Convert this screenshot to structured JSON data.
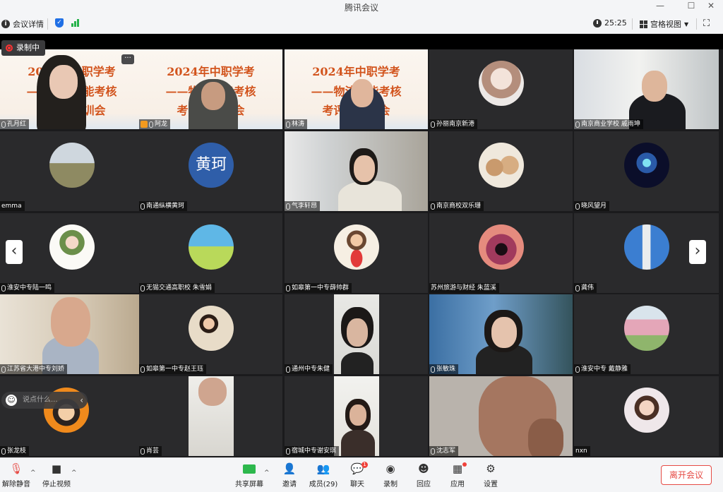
{
  "window": {
    "title": "腾讯会议",
    "minimize": "—",
    "maximize": "☐",
    "close": "✕"
  },
  "infobar": {
    "meeting_info": "会议详情",
    "timer": "25:25",
    "view_mode": "宫格视图"
  },
  "recording_badge": "录制中",
  "chat": {
    "placeholder": "说点什么..."
  },
  "slide": {
    "line1": "2024年中职学考",
    "line2": "——物流技能考核",
    "line3": "考评员培训会"
  },
  "tiles": [
    {
      "name": "孔月红"
    },
    {
      "name": "阿龙"
    },
    {
      "name": "林涛"
    },
    {
      "name": "孙丽南京新港"
    },
    {
      "name": "南京商业学校 戚雨坤"
    },
    {
      "name": "emma"
    },
    {
      "name": "南通纵横黄珂",
      "avatar_text": "黄珂"
    },
    {
      "name": "气李轩昂"
    },
    {
      "name": "南京商校双乐珊"
    },
    {
      "name": "晓风望月"
    },
    {
      "name": "淮安中专陆一鸣"
    },
    {
      "name": "无锡交通高职校 朱雪娟"
    },
    {
      "name": "如皋第一中专薛帅群"
    },
    {
      "name": "苏州旅游与财经 朱蓝溪"
    },
    {
      "name": "龚伟"
    },
    {
      "name": "江苏省大港中专刘娇"
    },
    {
      "name": "如皋第一中专赵王珏"
    },
    {
      "name": "通州中专朱健"
    },
    {
      "name": "张敏珠"
    },
    {
      "name": "淮安中专 戴静雅"
    },
    {
      "name": "张龙枝"
    },
    {
      "name": "肖芸"
    },
    {
      "name": "宿城中专谢安琪"
    },
    {
      "name": "沈志军"
    },
    {
      "name": "nxn"
    }
  ],
  "toolbar": {
    "unmute": "解除静音",
    "stop_video": "停止视频",
    "share_screen": "共享屏幕",
    "invite": "邀请",
    "members": "成员(29)",
    "chat": "聊天",
    "chat_badge": "1",
    "record": "录制",
    "reactions": "回应",
    "apps": "应用",
    "settings": "设置",
    "leave": "离开会议"
  },
  "colors": {
    "speaking_outline": "#2db84d",
    "leave_red": "#e64b45",
    "record_red": "#ff3333"
  }
}
